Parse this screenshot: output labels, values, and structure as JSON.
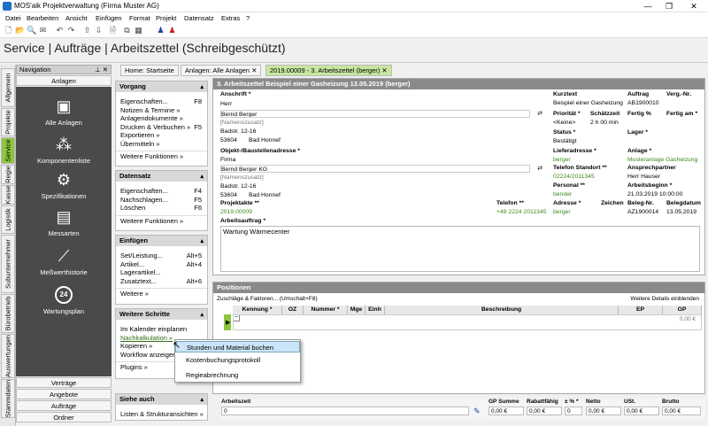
{
  "window": {
    "title": "MOS'aik Projektverwaltung (Firma Muster AG)"
  },
  "menu": [
    "Datei",
    "Bearbeiten",
    "Ansicht",
    "Einfügen",
    "Format",
    "Projekt",
    "Datensatz",
    "Extras",
    "?"
  ],
  "page_title": "Service | Aufträge | Arbeitszettel (Schreibgeschützt)",
  "vtabs": [
    "Allgemein",
    "Projekte",
    "Service",
    "Regie",
    "Kasse",
    "Logistik",
    "Subunternehmer",
    "Bürobetrieb",
    "Auswertungen",
    "Stammdaten"
  ],
  "nav": {
    "header": "Navigation",
    "top": "Anlagen",
    "items": [
      "Alle Anlagen",
      "Komponentenliste",
      "Spezifikationen",
      "Messarten",
      "Meßwerthistorie",
      "Wartungsplan"
    ],
    "wartung_badge": "24",
    "bottom": [
      "Verträge",
      "Angebote",
      "Aufträge",
      "Ordner"
    ]
  },
  "tabs": [
    "Home: Startseite",
    "Anlagen: Alle Anlagen",
    "2019.00009 - 3. Arbeitszettel (berger)"
  ],
  "side": {
    "vorgang": {
      "title": "Vorgang",
      "items": [
        [
          "Eigenschaften...",
          "F8"
        ],
        [
          "Notizen & Termine »",
          ""
        ],
        [
          "Anlagendokumente »",
          ""
        ],
        [
          "Drucken & Verbuchen »",
          "F5"
        ],
        [
          "Exportieren »",
          ""
        ],
        [
          "Übermitteln »",
          ""
        ]
      ],
      "more": "Weitere Funktionen »"
    },
    "datensatz": {
      "title": "Datensatz",
      "items": [
        [
          "Eigenschaften...",
          "F4"
        ],
        [
          "Nachschlagen...",
          "F5"
        ],
        [
          "Löschen",
          "F6"
        ]
      ],
      "more": "Weitere Funktionen »"
    },
    "einfuegen": {
      "title": "Einfügen",
      "items": [
        [
          "Set/Leistung...",
          "Alt+5"
        ],
        [
          "Artikel...",
          "Alt+4"
        ],
        [
          "Lagerartikel...",
          ""
        ],
        [
          "Zusatztext...",
          "Alt+6"
        ]
      ],
      "more": "Weitere »"
    },
    "schritte": {
      "title": "Weitere Schritte",
      "items": [
        [
          "Im Kalender einplanen",
          ""
        ],
        [
          "Nachkalkulation »",
          ""
        ],
        [
          "Kopieren »",
          ""
        ],
        [
          "Workflow anzeigen",
          ""
        ]
      ],
      "more": "Plugins »"
    },
    "siehe": {
      "title": "Siehe auch",
      "items": [
        [
          "Listen & Strukturansichten »",
          ""
        ]
      ]
    }
  },
  "form": {
    "header": "3. Arbeitszettel Beispiel einer Gasheizung 13.05.2019 (berger)",
    "anschrift_lbl": "Anschrift *",
    "anrede": "Herr",
    "name": "Bernd Berger",
    "zusatz": "[Namenszusatz]",
    "strasse": "Badstr. 12-16",
    "plz": "53604",
    "ort": "Bad Honnef",
    "objekt_lbl": "Objekt-/Baustellenadresse *",
    "o_anrede": "Firma",
    "o_name": "Bernd Berger KG",
    "o_zusatz": "[Namenszusatz]",
    "o_strasse": "Badstr. 12-16",
    "o_plz": "53604",
    "o_ort": "Bad Honnef",
    "projektakte_lbl": "Projektakte **",
    "projektakte": "2019.00009",
    "telefon_lbl": "Telefon **",
    "telefon": "+49 2224 2011345",
    "kurztext_lbl": "Kurztext",
    "kurztext": "Beispiel einer Gasheizung",
    "auftrag_lbl": "Auftrag",
    "auftrag": "AB1900010",
    "vergnr_lbl": "Verg.-Nr.",
    "prioritaet_lbl": "Priorität *",
    "prioritaet": "<Keine>",
    "schaetzzeit_lbl": "Schätzzeit",
    "schaetzzeit": "2 h 00 min",
    "fertig_lbl": "Fertig %",
    "fertigam_lbl": "Fertig am *",
    "status_lbl": "Status *",
    "status": "Bestätigt",
    "lager_lbl": "Lager *",
    "lieferadresse_lbl": "Lieferadresse *",
    "lieferadresse": "berger",
    "anlage_lbl": "Anlage *",
    "anlage": "Musteranlage Gasheizung",
    "telstandort_lbl": "Telefon Standort **",
    "telstandort": "02224/2011345",
    "ansprech_lbl": "Ansprechpartner",
    "ansprech": "Herr Hauser",
    "personal_lbl": "Personal **",
    "personal": "bender",
    "beginn_lbl": "Arbeitsbeginn *",
    "beginn": "21.03.2019 10:00:00",
    "adresse_lbl": "Adresse *",
    "adresse": "berger",
    "zeichen_lbl": "Zeichen",
    "belegnr_lbl": "Beleg-Nr.",
    "belegnr": "AZ1900014",
    "belegdatum_lbl": "Belegdatum",
    "belegdatum": "13.05.2019",
    "auftrag2_lbl": "Arbeitsauftrag *",
    "auftrag2": "Wartung Wärmecenter"
  },
  "positions": {
    "header": "Positionen",
    "hint": "Zuschläge & Faktoren... (Umschalt+F8)",
    "details": "Weitere Details einblenden",
    "cols": [
      "Kennung *",
      "OZ",
      "Nummer *",
      "Mge",
      "Einh",
      "Beschreibung",
      "EP",
      "GP"
    ],
    "gp_value": "0,00 €"
  },
  "summary": {
    "arbeitszeit_lbl": "Arbeitszeit",
    "arbeitszeit": "0",
    "cols": [
      [
        "GP Summe",
        "0,00 €"
      ],
      [
        "Rabattfähig",
        "0,00 €"
      ],
      [
        "± % *",
        "0"
      ],
      [
        "Netto",
        "0,00 €"
      ],
      [
        "USt.",
        "0,00 €"
      ],
      [
        "Brutto",
        "0,00 €"
      ]
    ]
  },
  "popup": [
    "Stunden und Material buchen",
    "Kostenbuchungsprotokoll",
    "Regieabrechnung"
  ]
}
